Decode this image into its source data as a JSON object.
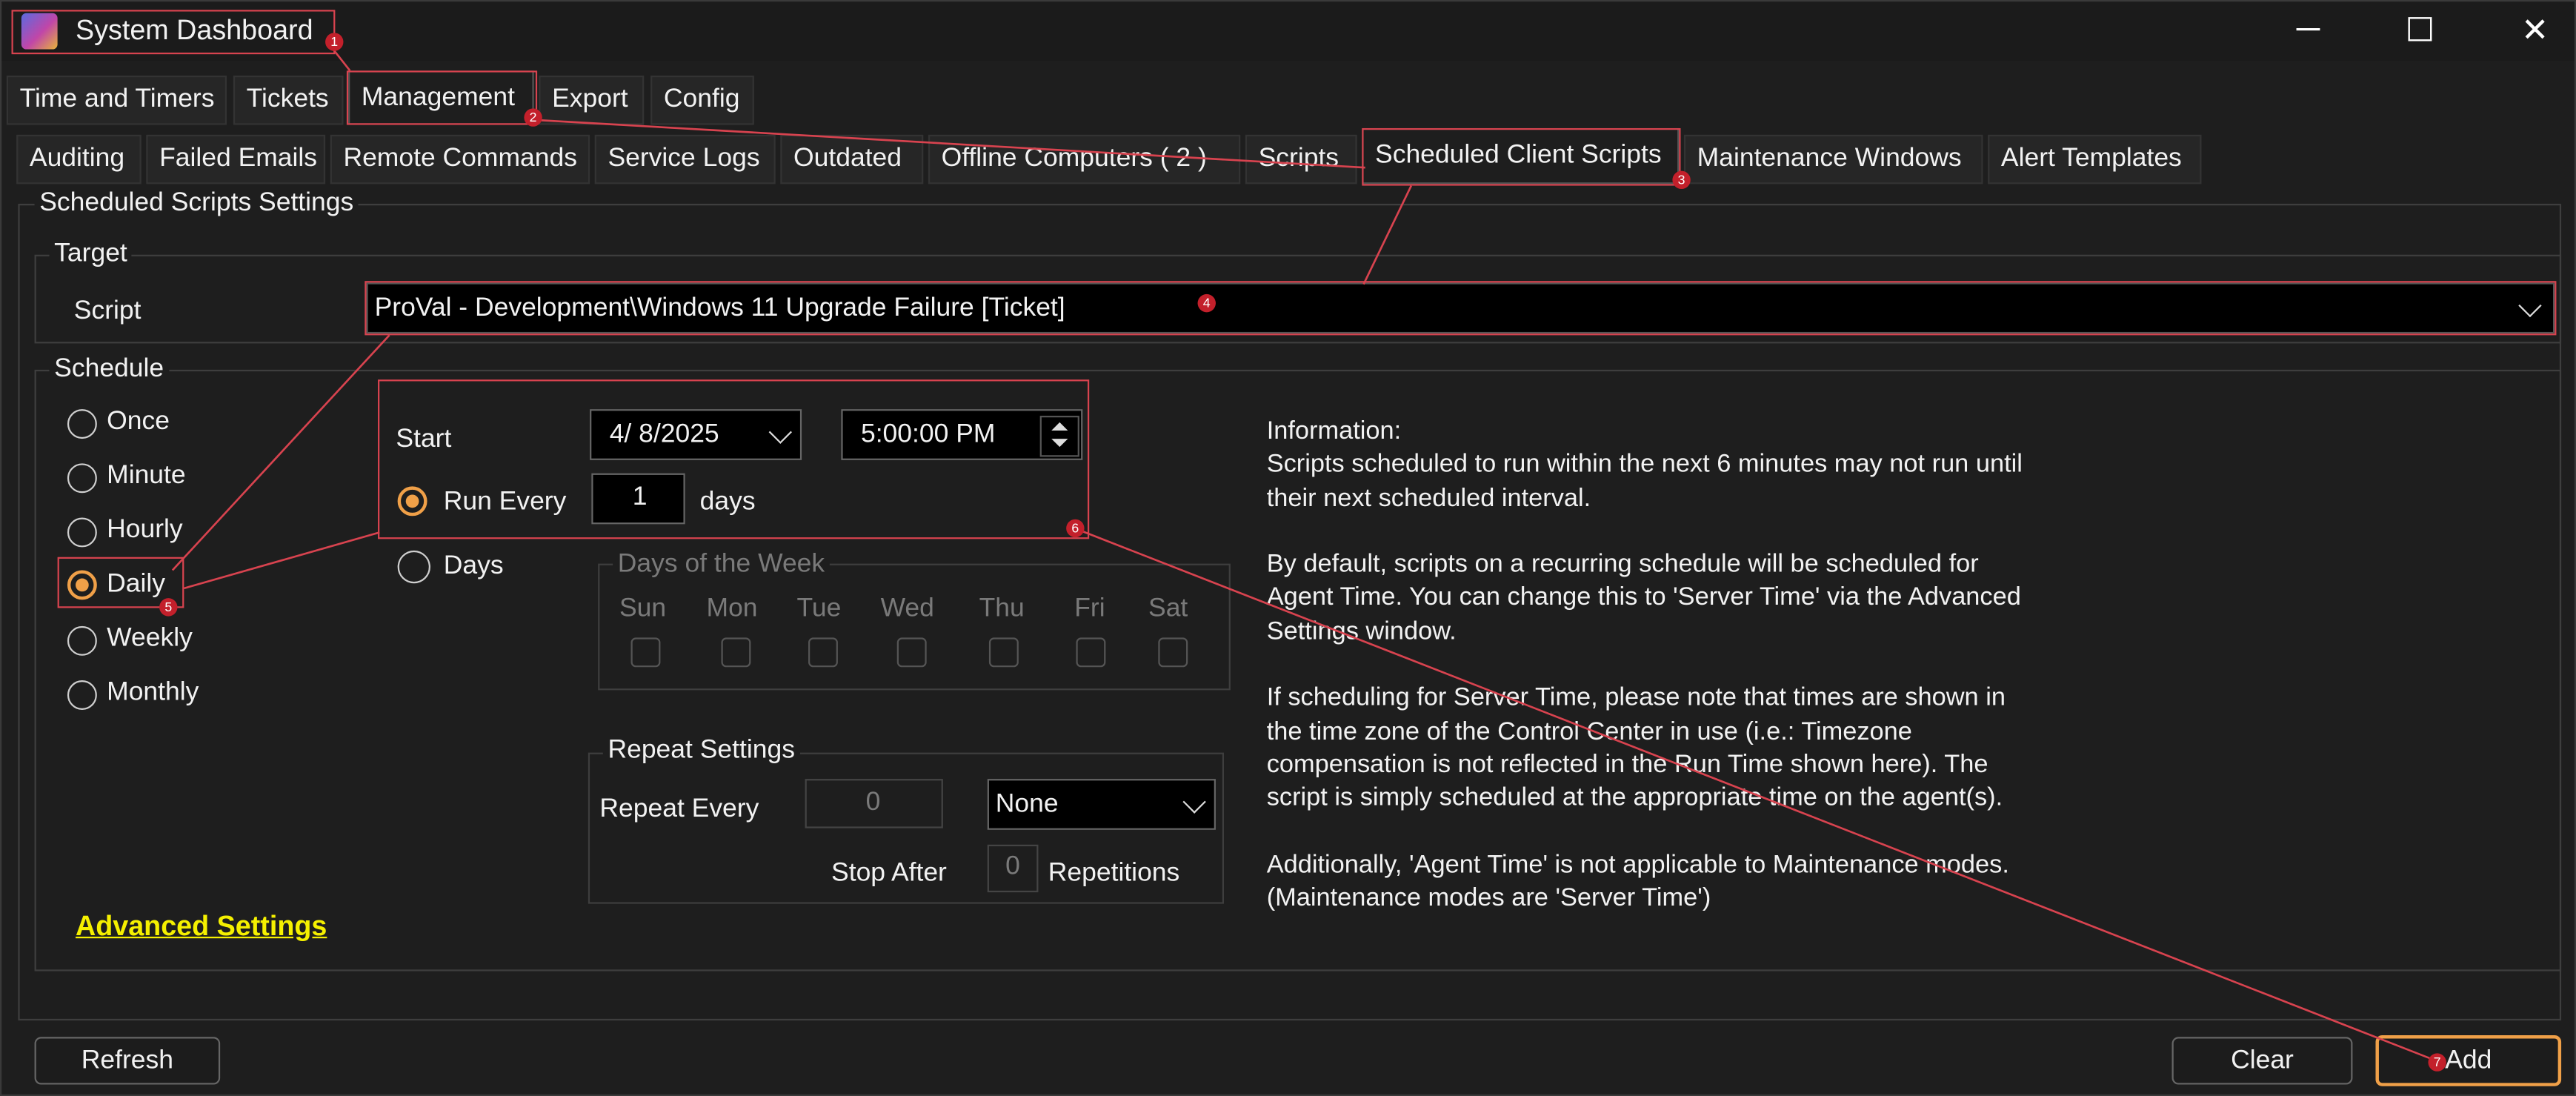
{
  "window": {
    "title": "System Dashboard",
    "controls": {
      "minimize": "─",
      "maximize": "☐",
      "close": "✕"
    }
  },
  "main_tabs": [
    "Time and Timers",
    "Tickets",
    "Management",
    "Export",
    "Config"
  ],
  "sub_tabs": [
    "Auditing",
    "Failed Emails",
    "Remote Commands",
    "Service Logs",
    "Outdated",
    "Offline Computers ( 2 )",
    "Scripts",
    "Scheduled Client Scripts",
    "Maintenance Windows",
    "Alert Templates"
  ],
  "settings": {
    "group_title": "Scheduled Scripts Settings",
    "target": {
      "title": "Target",
      "script_label": "Script",
      "script_value": "ProVal - Development\\Windows 11 Upgrade Failure [Ticket]"
    },
    "schedule": {
      "title": "Schedule",
      "options": [
        "Once",
        "Minute",
        "Hourly",
        "Daily",
        "Weekly",
        "Monthly"
      ],
      "selected": "Daily"
    },
    "start": {
      "label": "Start",
      "date": "4/ 8/2025",
      "time": "5:00:00 PM"
    },
    "run_every": {
      "label": "Run Every",
      "value": "1",
      "unit": "days"
    },
    "days": {
      "label": "Days",
      "group_title": "Days of the Week",
      "names": [
        "Sun",
        "Mon",
        "Tue",
        "Wed",
        "Thu",
        "Fri",
        "Sat"
      ]
    },
    "repeat": {
      "title": "Repeat Settings",
      "every_label": "Repeat Every",
      "every_value": "0",
      "unit_value": "None",
      "stop_label": "Stop After",
      "stop_value": "0",
      "stop_unit": "Repetitions"
    },
    "information": [
      "Information:",
      "Scripts scheduled to run within the next 6 minutes may not run until",
      "their next scheduled interval.",
      "",
      "By default, scripts on a recurring schedule will be scheduled for",
      "Agent Time. You can change this to 'Server Time' via the Advanced",
      "Settings window.",
      "",
      "If scheduling for Server Time, please note that times are shown in",
      "the time zone of the Control Center in use (i.e.: Timezone",
      "compensation is not reflected in the Run Time shown here). The",
      "script is simply scheduled at the appropriate time on the agent(s).",
      "",
      "Additionally, 'Agent Time' is not applicable to Maintenance modes.",
      "(Maintenance modes are 'Server Time')"
    ],
    "advanced_link": "Advanced Settings"
  },
  "buttons": {
    "refresh": "Refresh",
    "clear": "Clear",
    "add": "Add"
  },
  "annotations": [
    "1",
    "2",
    "3",
    "4",
    "5",
    "6",
    "7"
  ],
  "colors": {
    "background": "#1e1e1e",
    "accent_orange": "#f0a048",
    "link_yellow": "#f5f000",
    "annotation_red": "#d8434f"
  }
}
